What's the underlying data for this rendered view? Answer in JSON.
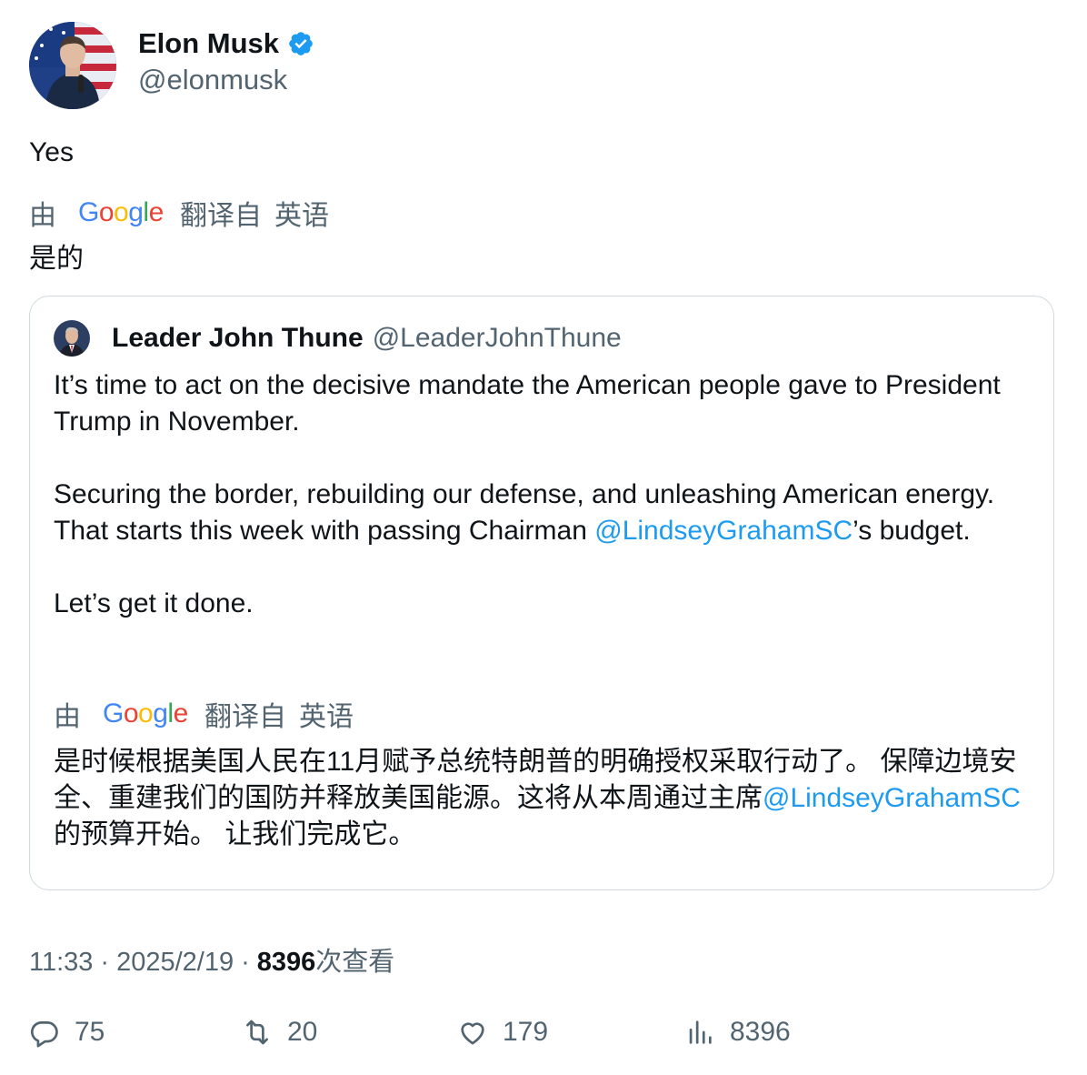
{
  "author": {
    "display_name": "Elon Musk",
    "handle": "@elonmusk",
    "verified": true,
    "avatar_icon": "profile-photo"
  },
  "tweet": {
    "text": "Yes",
    "translation_label_prefix": "由",
    "translation_provider": "Google",
    "translation_label_from": "翻译自",
    "translation_language": "英语",
    "translated_text": "是的"
  },
  "quote": {
    "display_name": "Leader John Thune",
    "handle": "@LeaderJohnThune",
    "paragraph1": "It’s time to act on the decisive mandate the American people gave to President Trump in November.",
    "paragraph2_before": "Securing the border, rebuilding our defense, and unleashing American energy. That starts this week with passing Chairman ",
    "paragraph2_mention": "@LindseyGrahamSC",
    "paragraph2_after": "’s budget.",
    "paragraph3": "Let’s get it done.",
    "translation_label_prefix": "由",
    "translation_provider": "Google",
    "translation_label_from": "翻译自",
    "translation_language": "英语",
    "translated_before": "是时候根据美国人民在11月赋予总统特朗普的明确授权采取行动了。 保障边境安全、重建我们的国防并释放美国能源。这将从本周通过主席",
    "translated_mention": "@LindseyGrahamSC",
    "translated_after": "的预算开始。 让我们完成它。"
  },
  "meta": {
    "time": "11:33",
    "separator": "·",
    "date": "2025/2/19",
    "views_count": "8396",
    "views_label": "次查看"
  },
  "actions": {
    "replies": "75",
    "retweets": "20",
    "likes": "179",
    "views": "8396"
  },
  "colors": {
    "text": "#0f1419",
    "secondary": "#536471",
    "link": "#1d9bf0",
    "verified_badge": "#1d9bf0",
    "border": "#cfd9de",
    "google_blue": "#4285F4",
    "google_red": "#EA4335",
    "google_yellow": "#FBBC05",
    "google_green": "#34A853"
  }
}
